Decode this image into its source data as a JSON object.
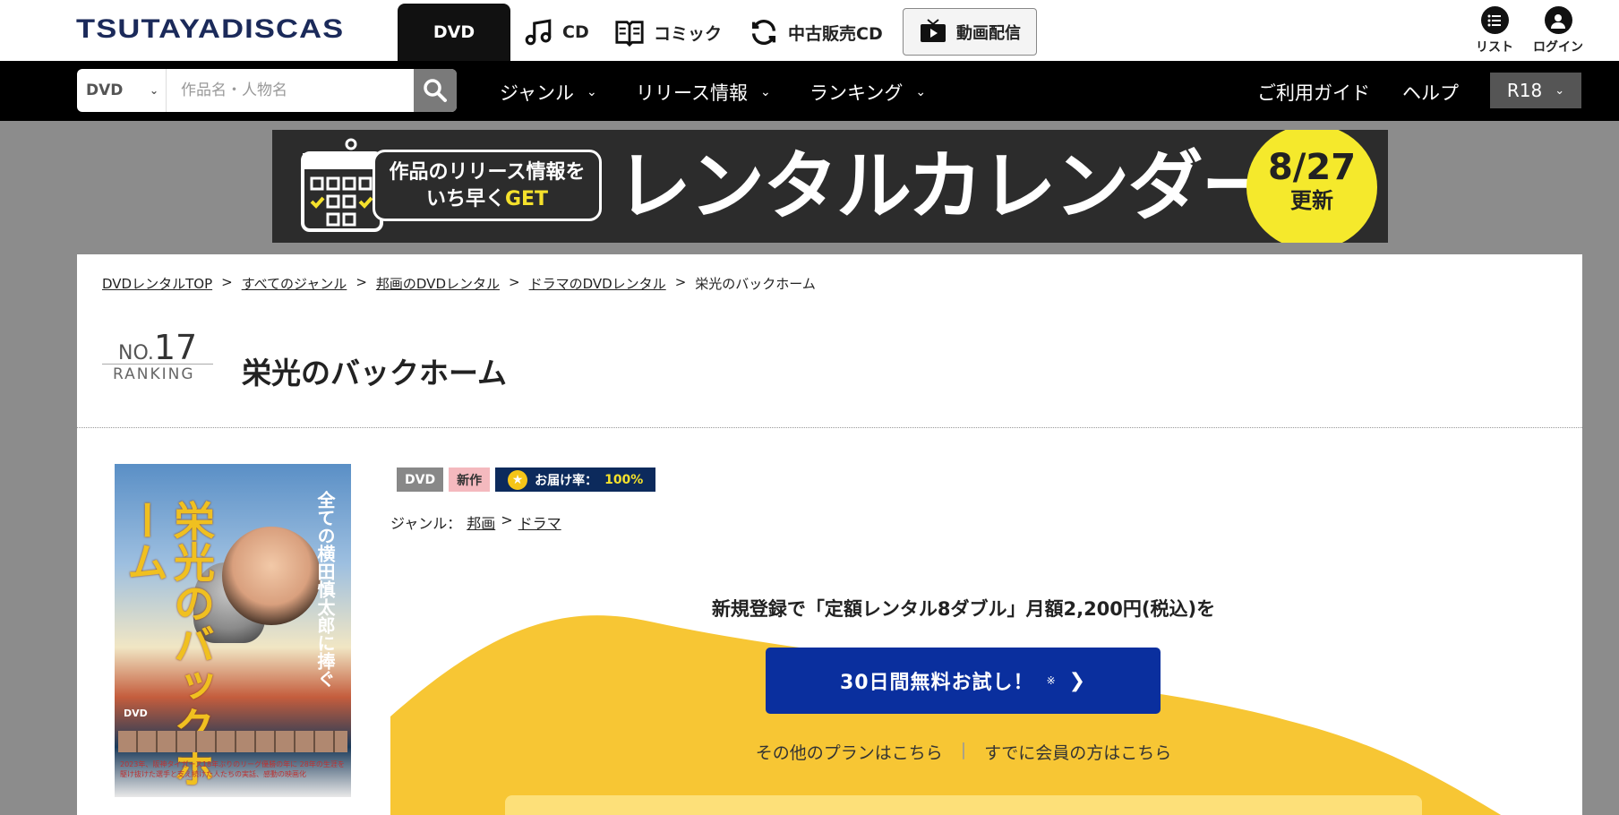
{
  "header": {
    "logo": "TSUTAYADISCAS",
    "tabs": [
      {
        "label": "DVD",
        "icon": "dvd",
        "active": true
      },
      {
        "label": "CD",
        "icon": "music-note-icon"
      },
      {
        "label": "コミック",
        "icon": "book-icon"
      },
      {
        "label": "中古販売CD",
        "icon": "refresh-icon"
      }
    ],
    "stream_label": "動画配信",
    "list_label": "リスト",
    "login_label": "ログイン"
  },
  "nav": {
    "search_category": "DVD",
    "search_placeholder": "作品名・人物名",
    "items": [
      "ジャンル",
      "リリース情報",
      "ランキング"
    ],
    "guide": "ご利用ガイド",
    "help": "ヘルプ",
    "r18": "R18"
  },
  "banner": {
    "bubble_line1": "作品のリリース情報を",
    "bubble_line2a": "いち早く",
    "bubble_line2b": "GET",
    "headline": "レンタルカレンダー",
    "date": "8/27",
    "update": "更新"
  },
  "breadcrumb": [
    {
      "label": "DVDレンタルTOP",
      "link": true
    },
    {
      "label": ">",
      "link": false
    },
    {
      "label": "すべてのジャンル",
      "link": true
    },
    {
      "label": ">",
      "link": false
    },
    {
      "label": "邦画のDVDレンタル",
      "link": true
    },
    {
      "label": ">",
      "link": false
    },
    {
      "label": "ドラマのDVDレンタル",
      "link": true
    },
    {
      "label": ">",
      "link": false
    },
    {
      "label": "栄光のバックホーム",
      "link": false
    }
  ],
  "ranking": {
    "prefix": "NO.",
    "number": "17",
    "label": "RANKING"
  },
  "title": "栄光のバックホーム",
  "poster": {
    "title": "栄光のバックホーム",
    "subtitle": "全ての横田慎太郎に捧ぐ",
    "dvd_mark": "DVD",
    "footer": "2023年、阪神タイガース18年ぶりのリーグ優勝の年に 28年の生涯を駆け抜けた選手と支え続けた人たちの実話、感動の映画化"
  },
  "badges": {
    "format": "DVD",
    "new": "新作",
    "rate_label": "お届け率：",
    "rate_value": "100%"
  },
  "genre": {
    "label": "ジャンル：",
    "main": "邦画",
    "sep": ">",
    "sub": "ドラマ"
  },
  "promo": {
    "text": "新規登録で「定額レンタル8ダブル」月額2,200円(税込)を",
    "button": "30日間無料お試し！",
    "button_note": "※",
    "link_other": "その他のプランはこちら",
    "link_sep": "|",
    "link_member": "すでに会員の方はこちら"
  },
  "colors": {
    "accent_blue": "#0a2f9e",
    "promo_yellow": "#f7c634",
    "banner_yellow": "#f5e92c",
    "navy_badge": "#0c2a5c"
  }
}
